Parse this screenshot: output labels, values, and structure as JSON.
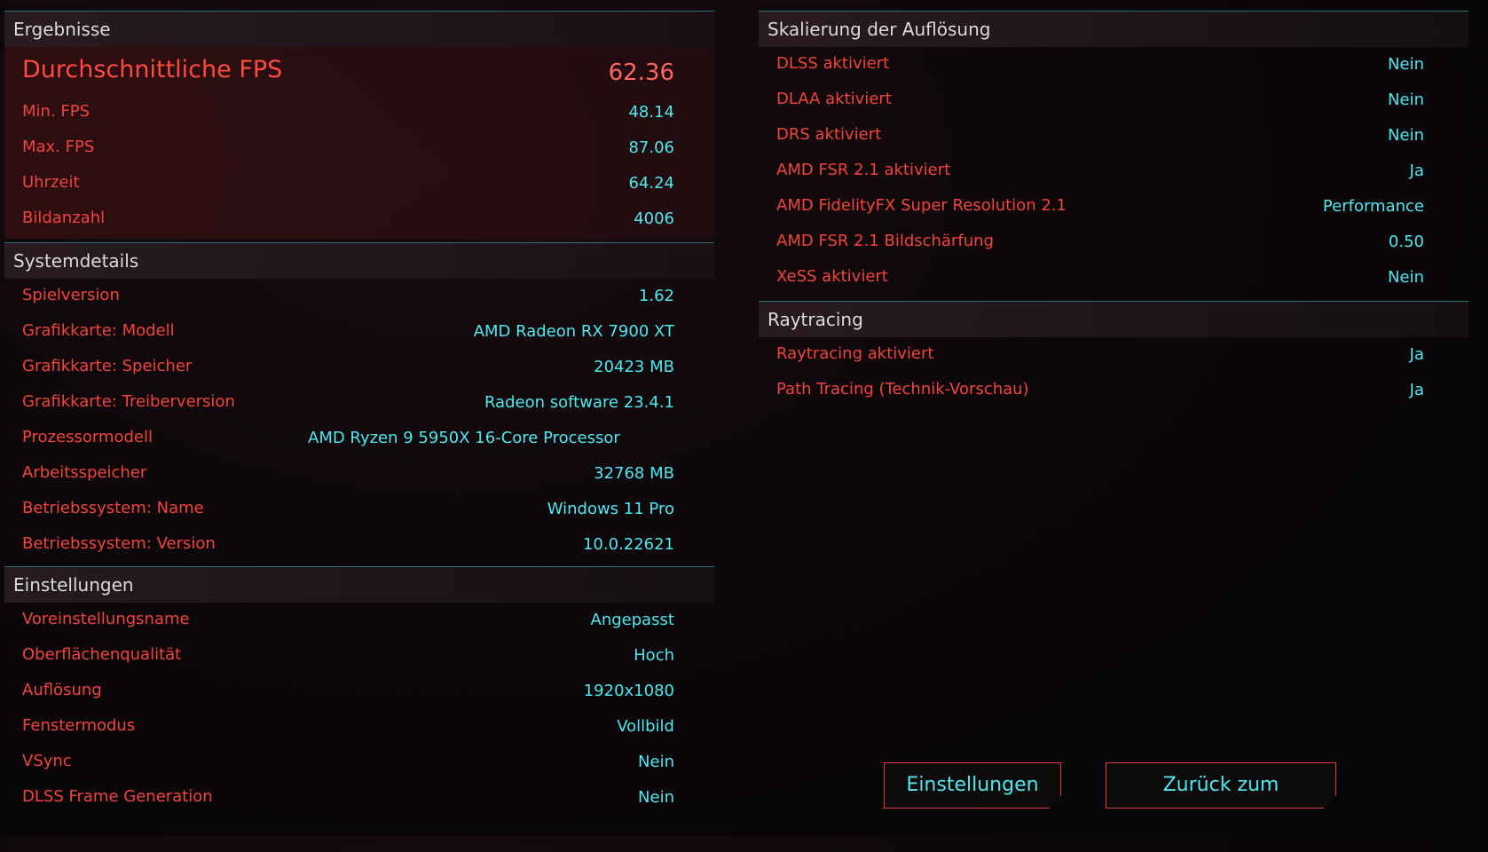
{
  "results": {
    "header": "Ergebnisse",
    "avg_label": "Durchschnittliche FPS",
    "avg_value": "62.36",
    "rows": [
      {
        "label": "Min. FPS",
        "value": "48.14"
      },
      {
        "label": "Max. FPS",
        "value": "87.06"
      },
      {
        "label": "Uhrzeit",
        "value": "64.24"
      },
      {
        "label": "Bildanzahl",
        "value": "4006"
      }
    ]
  },
  "system": {
    "header": "Systemdetails",
    "rows": [
      {
        "label": "Spielversion",
        "value": "1.62"
      },
      {
        "label": "Grafikkarte: Modell",
        "value": "AMD Radeon RX 7900 XT"
      },
      {
        "label": "Grafikkarte: Speicher",
        "value": "20423 MB"
      },
      {
        "label": "Grafikkarte: Treiberversion",
        "value": "Radeon software 23.4.1"
      },
      {
        "label": "Prozessormodell",
        "value": "AMD Ryzen 9 5950X 16-Core Processor"
      },
      {
        "label": "Arbeitsspeicher",
        "value": "32768 MB"
      },
      {
        "label": "Betriebssystem: Name",
        "value": "Windows 11 Pro"
      },
      {
        "label": "Betriebssystem: Version",
        "value": "10.0.22621"
      }
    ]
  },
  "settings": {
    "header": "Einstellungen",
    "rows": [
      {
        "label": "Voreinstellungsname",
        "value": "Angepasst"
      },
      {
        "label": "Oberflächenqualität",
        "value": "Hoch"
      },
      {
        "label": "Auflösung",
        "value": "1920x1080"
      },
      {
        "label": "Fenstermodus",
        "value": "Vollbild"
      },
      {
        "label": "VSync",
        "value": "Nein"
      },
      {
        "label": "DLSS Frame Generation",
        "value": "Nein"
      }
    ]
  },
  "scaling": {
    "header": "Skalierung der Auflösung",
    "rows": [
      {
        "label": "DLSS aktiviert",
        "value": "Nein"
      },
      {
        "label": "DLAA aktiviert",
        "value": "Nein"
      },
      {
        "label": "DRS aktiviert",
        "value": "Nein"
      },
      {
        "label": "AMD FSR 2.1 aktiviert",
        "value": "Ja"
      },
      {
        "label": "AMD FidelityFX Super Resolution 2.1",
        "value": "Performance"
      },
      {
        "label": "AMD FSR 2.1 Bildschärfung",
        "value": "0.50"
      },
      {
        "label": "XeSS aktiviert",
        "value": "Nein"
      }
    ]
  },
  "raytracing": {
    "header": "Raytracing",
    "rows": [
      {
        "label": "Raytracing aktiviert",
        "value": "Ja"
      },
      {
        "label": "Path Tracing (Technik-Vorschau)",
        "value": "Ja"
      }
    ]
  },
  "buttons": {
    "settings": "Einstellungen",
    "main_menu": "Zurück zum Hauptmenü"
  },
  "colors": {
    "label_red": "#f0443c",
    "value_cyan": "#4fe8ee",
    "divider": "#2e6f75"
  }
}
